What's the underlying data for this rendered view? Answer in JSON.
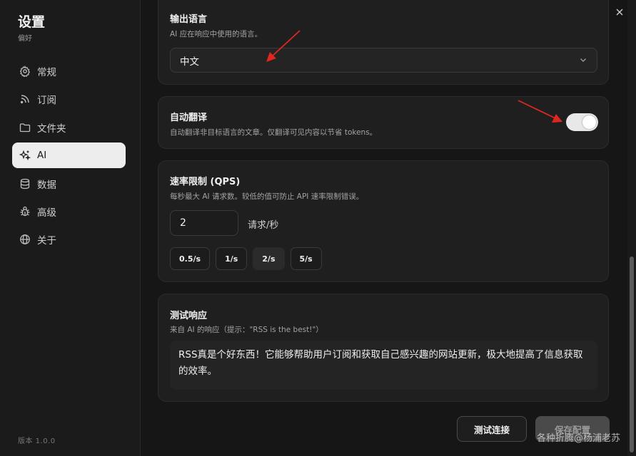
{
  "sidebar": {
    "title": "设置",
    "subtitle": "偏好",
    "items": [
      {
        "label": "常规",
        "icon": "gear-icon"
      },
      {
        "label": "订阅",
        "icon": "rss-icon"
      },
      {
        "label": "文件夹",
        "icon": "folder-icon"
      },
      {
        "label": "AI",
        "icon": "sparkles-icon",
        "active": true
      },
      {
        "label": "数据",
        "icon": "database-icon"
      },
      {
        "label": "高级",
        "icon": "bug-icon"
      },
      {
        "label": "关于",
        "icon": "globe-icon"
      }
    ],
    "version": "版本 1.0.0"
  },
  "output_language": {
    "title": "输出语言",
    "description": "AI 应在响应中使用的语言。",
    "selected": "中文"
  },
  "auto_translate": {
    "title": "自动翻译",
    "description": "自动翻译非目标语言的文章。仅翻译可见内容以节省 tokens。",
    "enabled": true
  },
  "rate_limit": {
    "title": "速率限制 (QPS)",
    "description": "每秒最大 AI 请求数。较低的值可防止 API 速率限制错误。",
    "value": "2",
    "unit": "请求/秒",
    "presets": [
      "0.5/s",
      "1/s",
      "2/s",
      "5/s"
    ],
    "selected_preset": "2/s"
  },
  "test_response": {
    "title": "测试响应",
    "description": "来自 AI 的响应（提示：\"RSS is the best!\"）",
    "response": "RSS真是个好东西！它能够帮助用户订阅和获取自己感兴趣的网站更新，极大地提高了信息获取的效率。"
  },
  "actions": {
    "test_label": "测试连接",
    "save_label": "保存配置"
  },
  "watermark": "各种折腾@杨浦老苏",
  "colors": {
    "background": "#161616",
    "card": "#1f1f1f",
    "active_nav": "#ededed",
    "annotation_arrow": "#e0261f"
  }
}
